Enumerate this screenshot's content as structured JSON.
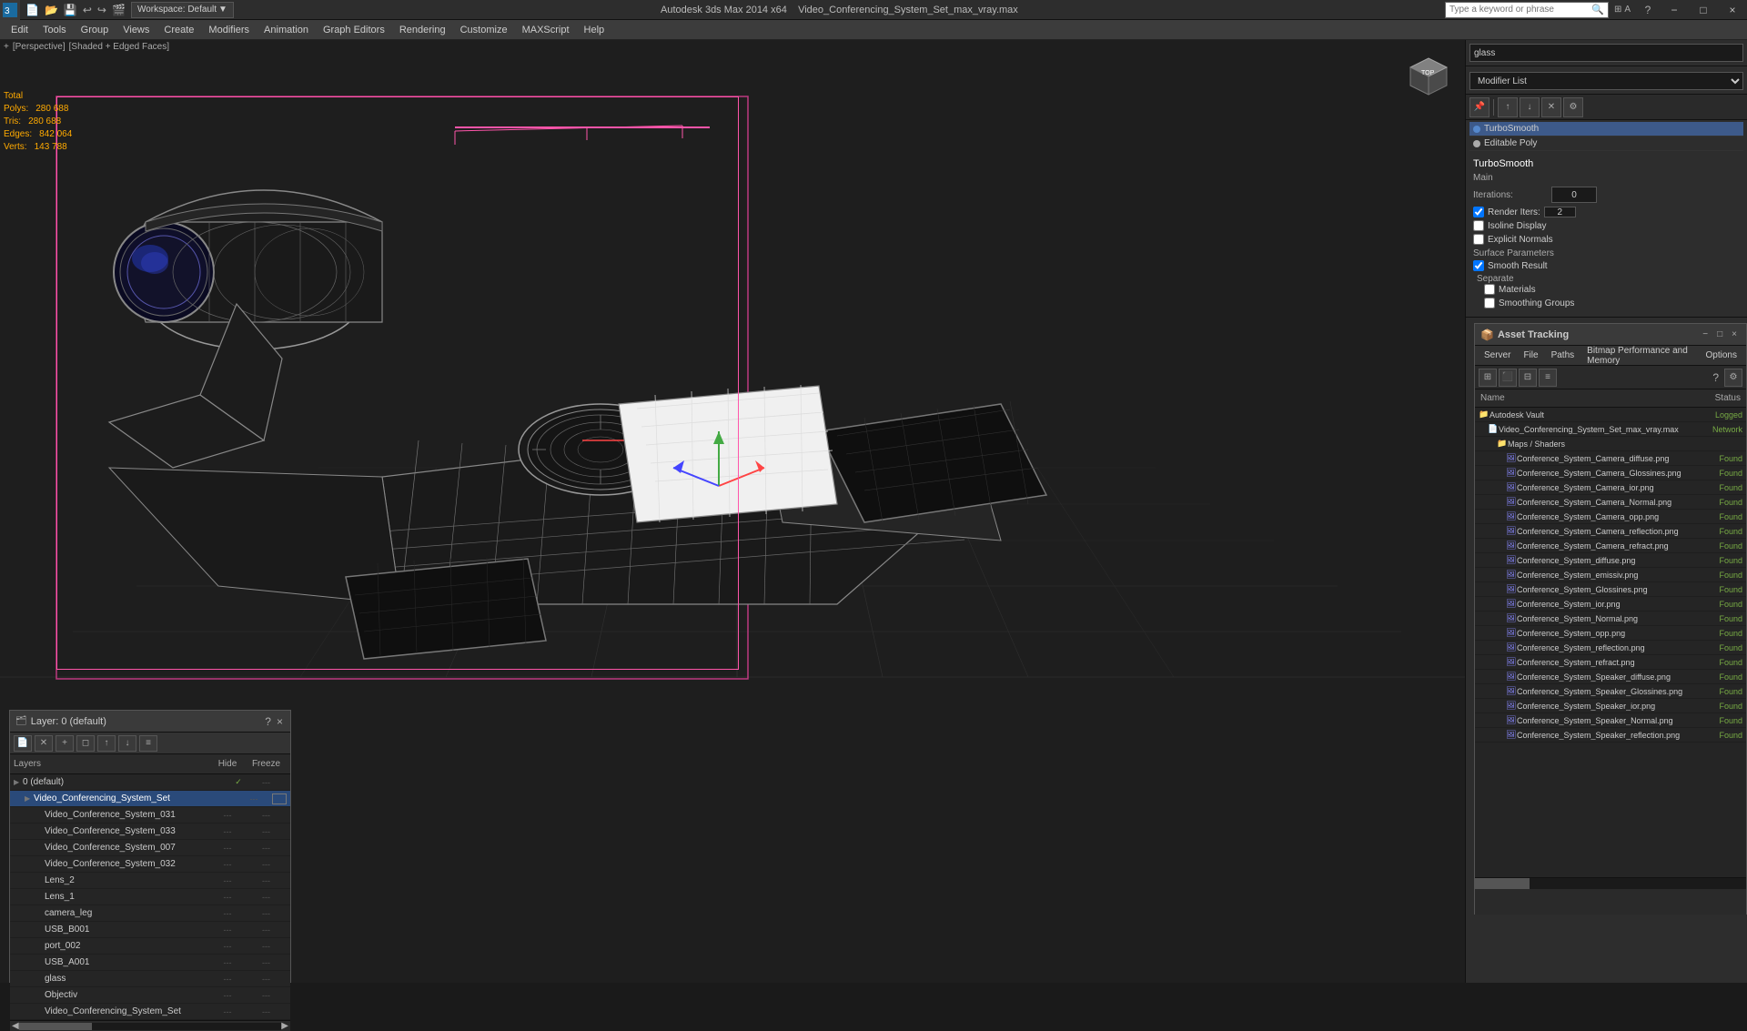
{
  "titleBar": {
    "appName": "Autodesk 3ds Max 2014 x64",
    "fileName": "Video_Conferencing_System_Set_max_vray.max",
    "workspace": "Workspace: Default",
    "searchPlaceholder": "Type a keyword or phrase",
    "orPhrase": "Or phrase",
    "windowBtns": {
      "minimize": "−",
      "restore": "□",
      "close": "×"
    }
  },
  "menuBar": {
    "items": [
      "Edit",
      "Tools",
      "Group",
      "Views",
      "Create",
      "Modifiers",
      "Animation",
      "Graph Editors",
      "Rendering",
      "Customize",
      "MAXScript",
      "Help"
    ]
  },
  "viewport": {
    "label": "[+] [Perspective] [Shaded + Edged Faces]",
    "stats": {
      "header": "Total",
      "polys": {
        "label": "Polys:",
        "value": "280 688"
      },
      "tris": {
        "label": "Tris:",
        "value": "280 688"
      },
      "edges": {
        "label": "Edges:",
        "value": "842 064"
      },
      "verts": {
        "label": "Verts:",
        "value": "143 788"
      }
    }
  },
  "rightPanel": {
    "searchValue": "glass",
    "modifierList": "Modifier List",
    "modifiers": [
      {
        "name": "TurboSmooth",
        "active": true
      },
      {
        "name": "Editable Poly",
        "active": false
      }
    ],
    "turboSmooth": {
      "title": "TurboSmooth",
      "mainLabel": "Main",
      "iterations": {
        "label": "Iterations:",
        "value": "0"
      },
      "renderIters": {
        "label": "Render Iters:",
        "value": "2",
        "checked": true
      },
      "isolineDisplay": {
        "label": "Isoline Display",
        "checked": false
      },
      "explicitNormals": {
        "label": "Explicit Normals",
        "checked": false
      },
      "surfaceParams": "Surface Parameters",
      "smoothResult": {
        "label": "Smooth Result",
        "checked": true
      },
      "separate": "Separate",
      "materials": {
        "label": "Materials",
        "checked": false
      },
      "smoothingGroups": {
        "label": "Smoothing Groups",
        "checked": false
      }
    }
  },
  "layersPanel": {
    "title": "Layer: 0 (default)",
    "columns": {
      "name": "Layers",
      "hide": "Hide",
      "freeze": "Freeze"
    },
    "items": [
      {
        "indent": 0,
        "name": "0 (default)",
        "check": "✓",
        "dash": "---",
        "freeze": "---"
      },
      {
        "indent": 1,
        "name": "Video_Conferencing_System_Set",
        "active": true,
        "dash": "---",
        "freeze": "---",
        "hasBox": true
      },
      {
        "indent": 2,
        "name": "Video_Conference_System_031",
        "dash": "---",
        "freeze": "---"
      },
      {
        "indent": 2,
        "name": "Video_Conference_System_033",
        "dash": "---",
        "freeze": "---"
      },
      {
        "indent": 2,
        "name": "Video_Conference_System_007",
        "dash": "---",
        "freeze": "---"
      },
      {
        "indent": 2,
        "name": "Video_Conference_System_032",
        "dash": "---",
        "freeze": "---"
      },
      {
        "indent": 2,
        "name": "Lens_2",
        "dash": "---",
        "freeze": "---"
      },
      {
        "indent": 2,
        "name": "Lens_1",
        "dash": "---",
        "freeze": "---"
      },
      {
        "indent": 2,
        "name": "camera_leg",
        "dash": "---",
        "freeze": "---"
      },
      {
        "indent": 2,
        "name": "USB_B001",
        "dash": "---",
        "freeze": "---"
      },
      {
        "indent": 2,
        "name": "port_002",
        "dash": "---",
        "freeze": "---"
      },
      {
        "indent": 2,
        "name": "USB_A001",
        "dash": "---",
        "freeze": "---"
      },
      {
        "indent": 2,
        "name": "glass",
        "dash": "---",
        "freeze": "---"
      },
      {
        "indent": 2,
        "name": "Objectiv",
        "dash": "---",
        "freeze": "---"
      },
      {
        "indent": 2,
        "name": "Video_Conferencing_System_Set",
        "dash": "---",
        "freeze": "---"
      }
    ]
  },
  "assetPanel": {
    "title": "Asset Tracking",
    "menuItems": [
      "Server",
      "File",
      "Paths",
      "Bitmap Performance and Memory",
      "Options"
    ],
    "columns": {
      "name": "Name",
      "status": "Status"
    },
    "items": [
      {
        "indent": 0,
        "name": "Autodesk Vault",
        "status": "Logged",
        "statusClass": "status-logged",
        "isFolder": true
      },
      {
        "indent": 1,
        "name": "Video_Conferencing_System_Set_max_vray.max",
        "status": "Network",
        "statusClass": "status-network",
        "isFile": true
      },
      {
        "indent": 2,
        "name": "Maps / Shaders",
        "status": "",
        "isFolder": true
      },
      {
        "indent": 3,
        "name": "Conference_System_Camera_diffuse.png",
        "status": "Found",
        "statusClass": "status-found"
      },
      {
        "indent": 3,
        "name": "Conference_System_Camera_Glossines.png",
        "status": "Found",
        "statusClass": "status-found"
      },
      {
        "indent": 3,
        "name": "Conference_System_Camera_ior.png",
        "status": "Found",
        "statusClass": "status-found"
      },
      {
        "indent": 3,
        "name": "Conference_System_Camera_Normal.png",
        "status": "Found",
        "statusClass": "status-found"
      },
      {
        "indent": 3,
        "name": "Conference_System_Camera_opp.png",
        "status": "Found",
        "statusClass": "status-found"
      },
      {
        "indent": 3,
        "name": "Conference_System_Camera_reflection.png",
        "status": "Found",
        "statusClass": "status-found"
      },
      {
        "indent": 3,
        "name": "Conference_System_Camera_refract.png",
        "status": "Found",
        "statusClass": "status-found"
      },
      {
        "indent": 3,
        "name": "Conference_System_diffuse.png",
        "status": "Found",
        "statusClass": "status-found"
      },
      {
        "indent": 3,
        "name": "Conference_System_emissiv.png",
        "status": "Found",
        "statusClass": "status-found"
      },
      {
        "indent": 3,
        "name": "Conference_System_Glossines.png",
        "status": "Found",
        "statusClass": "status-found"
      },
      {
        "indent": 3,
        "name": "Conference_System_ior.png",
        "status": "Found",
        "statusClass": "status-found"
      },
      {
        "indent": 3,
        "name": "Conference_System_Normal.png",
        "status": "Found",
        "statusClass": "status-found"
      },
      {
        "indent": 3,
        "name": "Conference_System_opp.png",
        "status": "Found",
        "statusClass": "status-found"
      },
      {
        "indent": 3,
        "name": "Conference_System_reflection.png",
        "status": "Found",
        "statusClass": "status-found"
      },
      {
        "indent": 3,
        "name": "Conference_System_refract.png",
        "status": "Found",
        "statusClass": "status-found"
      },
      {
        "indent": 3,
        "name": "Conference_System_Speaker_diffuse.png",
        "status": "Found",
        "statusClass": "status-found"
      },
      {
        "indent": 3,
        "name": "Conference_System_Speaker_Glossines.png",
        "status": "Found",
        "statusClass": "status-found"
      },
      {
        "indent": 3,
        "name": "Conference_System_Speaker_ior.png",
        "status": "Found",
        "statusClass": "status-found"
      },
      {
        "indent": 3,
        "name": "Conference_System_Speaker_Normal.png",
        "status": "Found",
        "statusClass": "status-found"
      },
      {
        "indent": 3,
        "name": "Conference_System_Speaker_reflection.png",
        "status": "Found",
        "statusClass": "status-found"
      }
    ]
  }
}
